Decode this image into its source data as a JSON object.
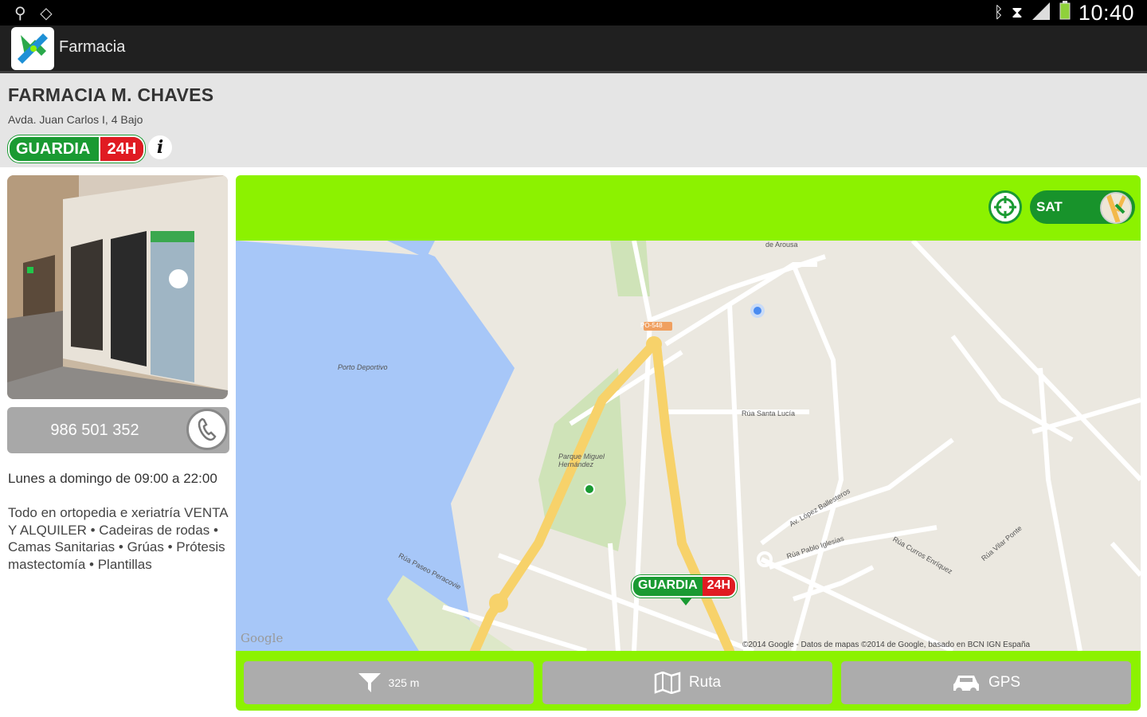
{
  "status_bar": {
    "left_icons": [
      "usb-icon",
      "sync-icon"
    ],
    "right_icons": [
      "bluetooth-icon",
      "alarm-icon",
      "signal-icon",
      "battery-icon"
    ],
    "time": "10:40"
  },
  "action_bar": {
    "title": "Farmacia",
    "icon": "pharmacy-logo-icon"
  },
  "pharmacy": {
    "name": "FARMACIA M. CHAVES",
    "address": "Avda. Juan Carlos I, 4 Bajo",
    "badge": {
      "guardia": "GUARDIA",
      "hours": "24H"
    },
    "info_icon": "i",
    "phone": "986 501 352",
    "hours_text": "Lunes a domingo de 09:00 a 22:00",
    "description": "Todo en ortopedia e xeriatría VENTA Y ALQUILER  • Cadeiras de rodas  • Camas Sanitarias  • Grúas  • Prótesis mastectomía  •  Plantillas"
  },
  "map": {
    "toggle_label": "SAT",
    "marker": {
      "guardia": "GUARDIA",
      "hours": "24H"
    },
    "labels": {
      "porto": "Porto Deportivo",
      "parque": "Parque Miguel Hernández",
      "arousa": "de Arousa",
      "santa_lucia": "Rúa Santa Lucía",
      "lopez": "Av. López Ballesteros",
      "pablo": "Rúa Pablo Iglesias",
      "curros": "Rúa Curros Enríquez",
      "vilar": "Rúa Vilar Ponte",
      "paseo": "Rúa Paseo Peracovie",
      "attribution": "©2014 Google - Datos de mapas ©2014 de Google, basado en BCN IGN España",
      "google": "Google",
      "road_tag": "PO-548"
    }
  },
  "buttons": {
    "distance": "325 m",
    "ruta": "Ruta",
    "gps": "GPS"
  },
  "colors": {
    "accent_green": "#8cf200",
    "brand_green": "#1a9a32",
    "brand_red": "#e01b22",
    "button_gray": "#acacac"
  }
}
